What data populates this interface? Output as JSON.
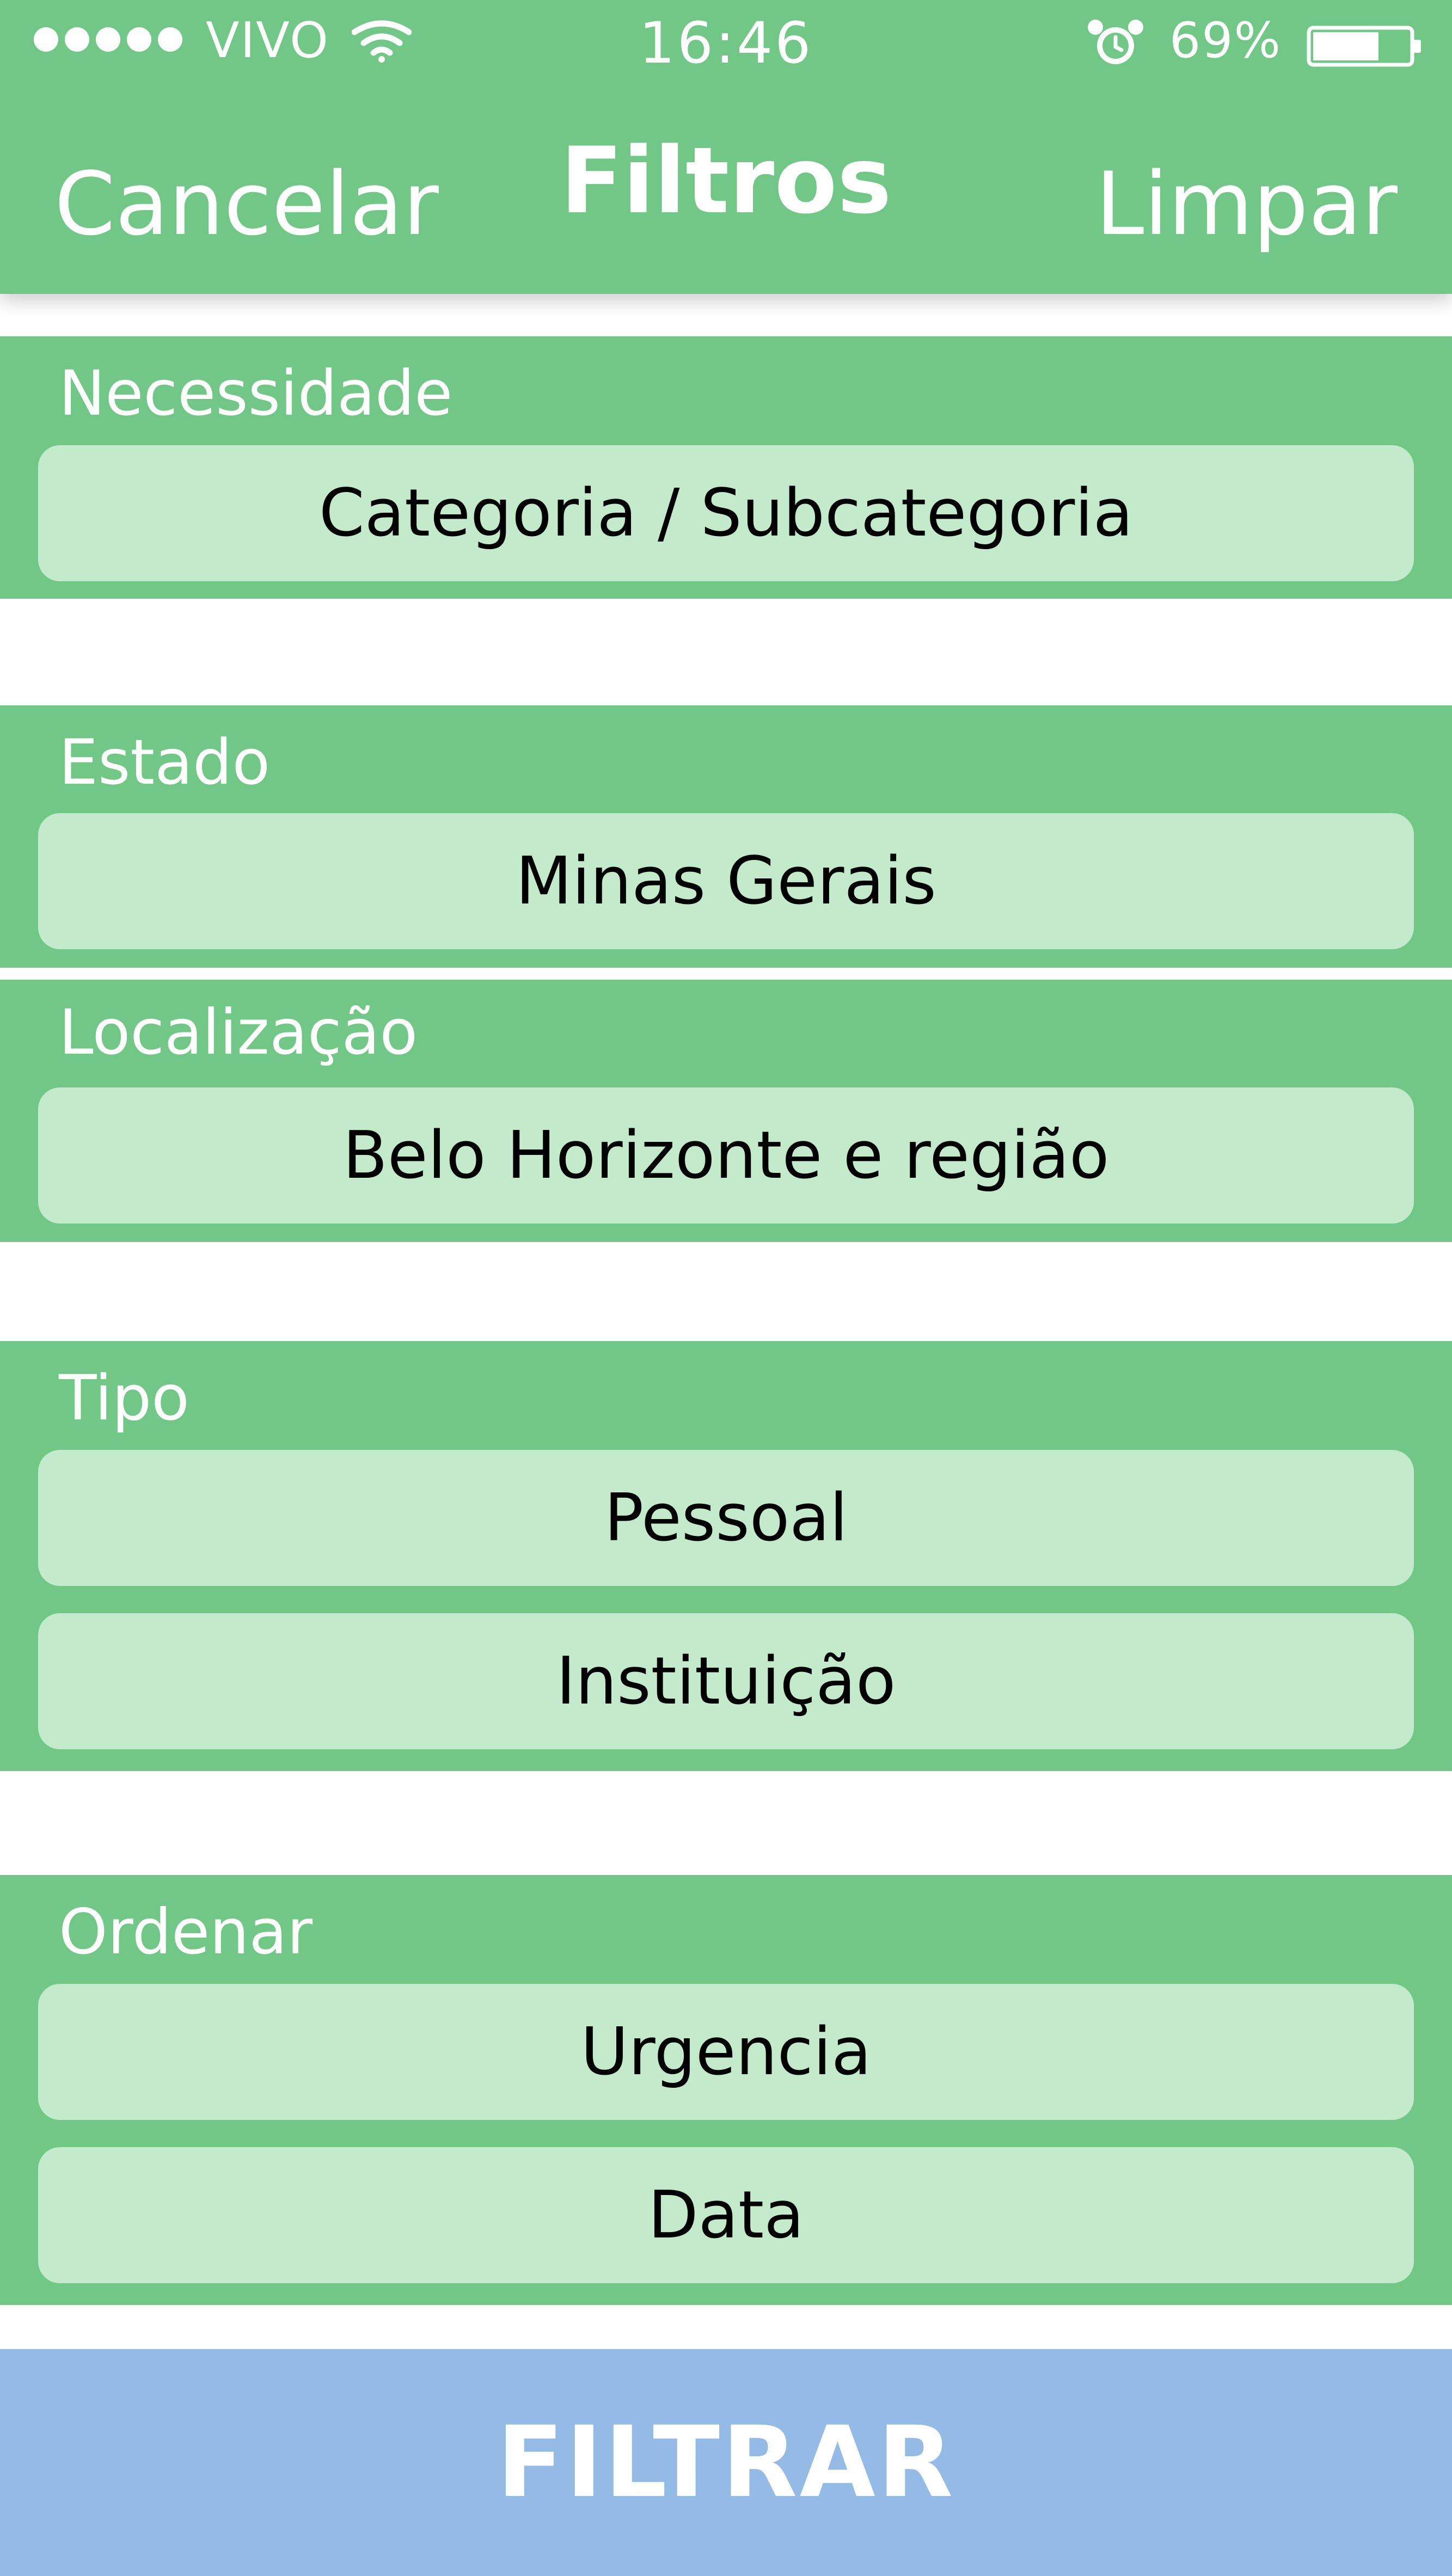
{
  "status_bar": {
    "carrier": "VIVO",
    "time": "16:46",
    "battery": "69%",
    "battery_level": 0.69,
    "icons": [
      "signal-dots-icon",
      "wifi-icon",
      "alarm-clock-icon",
      "battery-icon"
    ]
  },
  "header": {
    "cancel_label": "Cancelar",
    "title": "Filtros",
    "clear_label": "Limpar"
  },
  "sections": {
    "necessidade": {
      "label": "Necessidade",
      "options": [
        "Categoria / Subcategoria"
      ]
    },
    "estado": {
      "label": "Estado",
      "options": [
        "Minas Gerais"
      ]
    },
    "localizacao": {
      "label": "Localização",
      "options": [
        "Belo Horizonte e região"
      ]
    },
    "tipo": {
      "label": "Tipo",
      "options": [
        "Pessoal",
        "Instituição"
      ]
    },
    "ordenar": {
      "label": "Ordenar",
      "options": [
        "Urgencia",
        "Data"
      ]
    }
  },
  "footer": {
    "filter_label": "FILTRAR"
  },
  "colors": {
    "primary_green": "#71c886",
    "option_green": "#c3ebcb",
    "filter_blue": "#94bbe5",
    "text_white": "#ffffff"
  }
}
